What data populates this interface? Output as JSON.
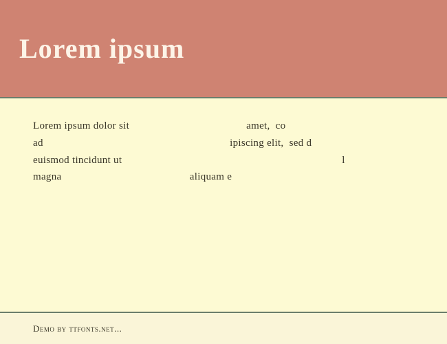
{
  "header": {
    "title": "Lorem ipsum"
  },
  "content": {
    "line1_left": "Lorem ipsum dolor sit",
    "line1_right": "amet,  co",
    "line2_left": "ad",
    "line2_right": "ipiscing elit,  sed d",
    "line3_left": "euismod tincidunt ut",
    "line3_right": "l",
    "line4_left": "magna",
    "line4_mid": "aliquam e"
  },
  "footer": {
    "text": "Demo by ttfonts.net..."
  }
}
